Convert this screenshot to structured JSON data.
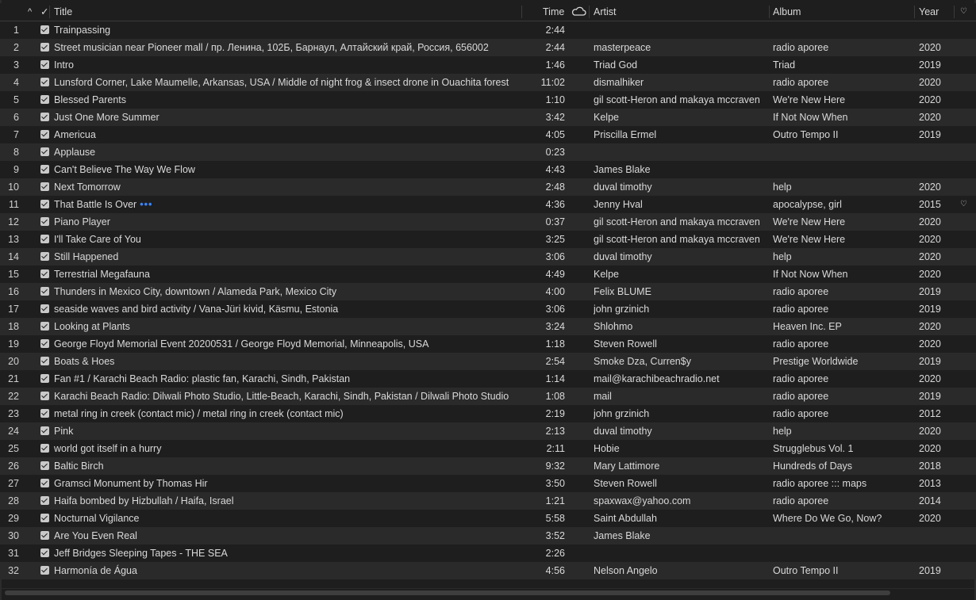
{
  "columns": {
    "sort_indicator": "^",
    "check": "✓",
    "title": "Title",
    "time": "Time",
    "cloud_icon": "cloud-icon",
    "artist": "Artist",
    "album": "Album",
    "year": "Year",
    "heart_icon": "heart-icon"
  },
  "accent_color": "#3a86ff",
  "rows": [
    {
      "num": "1",
      "title": "Trainpassing",
      "time": "2:44",
      "artist": "",
      "album": "",
      "year": ""
    },
    {
      "num": "2",
      "title": "Street musician near Pioneer mall / пр. Ленина, 102Б, Барнаул, Алтайский край, Россия, 656002",
      "time": "2:44",
      "artist": "masterpeace",
      "album": "radio aporee",
      "year": "2020"
    },
    {
      "num": "3",
      "title": "Intro",
      "time": "1:46",
      "artist": "Triad God",
      "album": "Triad",
      "year": "2019"
    },
    {
      "num": "4",
      "title": "Lunsford Corner, Lake Maumelle, Arkansas, USA / Middle of night frog & insect drone in Ouachita forest",
      "time": "11:02",
      "artist": "dismalhiker",
      "album": "radio aporee",
      "year": "2020"
    },
    {
      "num": "5",
      "title": "Blessed Parents",
      "time": "1:10",
      "artist": "gil scott-Heron and makaya mccraven",
      "album": "We're New Here",
      "year": "2020"
    },
    {
      "num": "6",
      "title": "Just One More Summer",
      "time": "3:42",
      "artist": "Kelpe",
      "album": "If Not Now When",
      "year": "2020"
    },
    {
      "num": "7",
      "title": "Americua",
      "time": "4:05",
      "artist": "Priscilla Ermel",
      "album": "Outro Tempo II",
      "year": "2019"
    },
    {
      "num": "8",
      "title": "Applause",
      "time": "0:23",
      "artist": "",
      "album": "",
      "year": ""
    },
    {
      "num": "9",
      "title": " Can't Believe The Way We Flow",
      "time": "4:43",
      "artist": "James Blake",
      "album": "",
      "year": ""
    },
    {
      "num": "10",
      "title": "Next Tomorrow",
      "time": "2:48",
      "artist": "duval timothy",
      "album": "help",
      "year": "2020"
    },
    {
      "num": "11",
      "title": "That Battle Is Over",
      "time": "4:36",
      "artist": "Jenny Hval",
      "album": "apocalypse, girl",
      "year": "2015",
      "more": "•••",
      "loved": "♡"
    },
    {
      "num": "12",
      "title": "Piano Player",
      "time": "0:37",
      "artist": "gil scott-Heron and makaya mccraven",
      "album": "We're New Here",
      "year": "2020"
    },
    {
      "num": "13",
      "title": "I'll Take Care of You",
      "time": "3:25",
      "artist": "gil scott-Heron and makaya mccraven",
      "album": "We're New Here",
      "year": "2020"
    },
    {
      "num": "14",
      "title": "Still Happened",
      "time": "3:06",
      "artist": "duval timothy",
      "album": "help",
      "year": "2020"
    },
    {
      "num": "15",
      "title": "Terrestrial Megafauna",
      "time": "4:49",
      "artist": "Kelpe",
      "album": "If Not Now When",
      "year": "2020"
    },
    {
      "num": "16",
      "title": "Thunders in Mexico City, downtown / Alameda Park, Mexico City",
      "time": "4:00",
      "artist": "Felix BLUME",
      "album": "radio aporee",
      "year": "2019"
    },
    {
      "num": "17",
      "title": "seaside waves and bird activity / Vana-Jüri kivid, Käsmu, Estonia",
      "time": "3:06",
      "artist": "john grzinich",
      "album": "radio aporee",
      "year": "2019"
    },
    {
      "num": "18",
      "title": "Looking at Plants",
      "time": "3:24",
      "artist": "Shlohmo",
      "album": "Heaven Inc. EP",
      "year": "2020"
    },
    {
      "num": "19",
      "title": "George Floyd Memorial Event 20200531 / George Floyd Memorial, Minneapolis, USA",
      "time": "1:18",
      "artist": "Steven Rowell",
      "album": "radio aporee",
      "year": "2020"
    },
    {
      "num": "20",
      "title": "Boats & Hoes",
      "time": "2:54",
      "artist": "Smoke Dza, Curren$y",
      "album": "Prestige Worldwide",
      "year": "2019"
    },
    {
      "num": "21",
      "title": "Fan #1 / Karachi Beach Radio: plastic fan, Karachi, Sindh, Pakistan",
      "time": "1:14",
      "artist": "mail@karachibeachradio.net",
      "album": "radio aporee",
      "year": "2020"
    },
    {
      "num": "22",
      "title": "Karachi Beach Radio: Dilwali Photo Studio, Little-Beach, Karachi, Sindh, Pakistan / Dilwali Photo Studio",
      "time": "1:08",
      "artist": "mail",
      "album": "radio aporee",
      "year": "2019"
    },
    {
      "num": "23",
      "title": "metal ring in creek (contact mic) / metal ring in creek (contact mic)",
      "time": "2:19",
      "artist": "john grzinich",
      "album": "radio aporee",
      "year": "2012"
    },
    {
      "num": "24",
      "title": "Pink",
      "time": "2:13",
      "artist": "duval timothy",
      "album": "help",
      "year": "2020"
    },
    {
      "num": "25",
      "title": "world got itself in a hurry",
      "time": "2:11",
      "artist": "Hobie",
      "album": "Strugglebus Vol. 1",
      "year": "2020"
    },
    {
      "num": "26",
      "title": "Baltic Birch",
      "time": "9:32",
      "artist": "Mary Lattimore",
      "album": "Hundreds of Days",
      "year": "2018"
    },
    {
      "num": "27",
      "title": "Gramsci Monument by Thomas Hir",
      "time": "3:50",
      "artist": "Steven Rowell",
      "album": "radio aporee ::: maps",
      "year": "2013"
    },
    {
      "num": "28",
      "title": "Haifa bombed by Hizbullah / Haifa, Israel",
      "time": "1:21",
      "artist": "spaxwax@yahoo.com",
      "album": "radio aporee",
      "year": "2014"
    },
    {
      "num": "29",
      "title": "Nocturnal Vigilance",
      "time": "5:58",
      "artist": "Saint Abdullah",
      "album": "Where Do We Go, Now?",
      "year": "2020"
    },
    {
      "num": "30",
      "title": "Are You Even Real",
      "time": "3:52",
      "artist": "James Blake",
      "album": "",
      "year": ""
    },
    {
      "num": "31",
      "title": "Jeff Bridges Sleeping Tapes - THE SEA",
      "time": "2:26",
      "artist": "",
      "album": "",
      "year": ""
    },
    {
      "num": "32",
      "title": "Harmonía de Água",
      "time": "4:56",
      "artist": "Nelson Angelo",
      "album": "Outro Tempo II",
      "year": "2019"
    }
  ]
}
